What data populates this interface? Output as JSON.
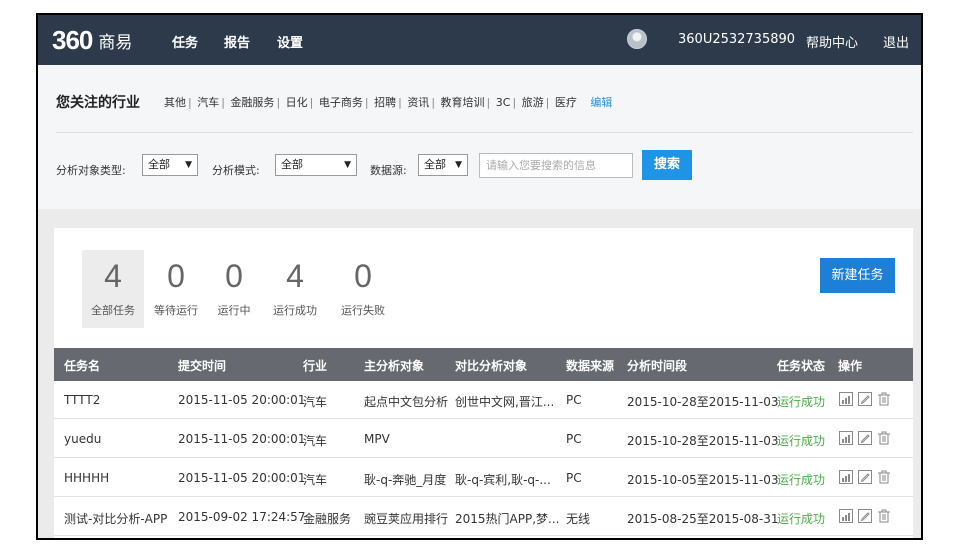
{
  "nav": {
    "logo_mark": "360",
    "logo_text": "商易",
    "links": [
      "任务",
      "报告",
      "设置"
    ],
    "username": "360U2532735890",
    "help": "帮助中心",
    "logout": "退出"
  },
  "filter": {
    "industry_title": "您关注的行业",
    "industries": [
      "其他",
      "汽车",
      "金融服务",
      "日化",
      "电子商务",
      "招聘",
      "资讯",
      "教育培训",
      "3C",
      "旅游",
      "医疗"
    ],
    "edit": "编辑",
    "target_type_label": "分析对象类型:",
    "target_type_value": "全部",
    "mode_label": "分析模式:",
    "mode_value": "全部",
    "source_label": "数据源:",
    "source_value": "全部",
    "search_placeholder": "请输入您要搜索的信息",
    "search_button": "搜索"
  },
  "stats": [
    {
      "value": "4",
      "label": "全部任务"
    },
    {
      "value": "0",
      "label": "等待运行"
    },
    {
      "value": "0",
      "label": "运行中"
    },
    {
      "value": "4",
      "label": "运行成功"
    },
    {
      "value": "0",
      "label": "运行失败"
    }
  ],
  "new_task": "新建任务",
  "table": {
    "headers": [
      "任务名",
      "提交时间",
      "行业",
      "主分析对象",
      "对比分析对象",
      "数据来源",
      "分析时间段",
      "任务状态",
      "操作"
    ],
    "rows": [
      [
        "TTTT2",
        "2015-11-05 20:00:01",
        "汽车",
        "起点中文包分析",
        "创世中文网,晋江...",
        "PC",
        "2015-10-28至2015-11-03",
        "运行成功"
      ],
      [
        "yuedu",
        "2015-11-05 20:00:01",
        "汽车",
        "MPV",
        "",
        "PC",
        "2015-10-28至2015-11-03",
        "运行成功"
      ],
      [
        "HHHHH",
        "2015-11-05 20:00:01",
        "汽车",
        "耿-q-奔驰_月度",
        "耿-q-宾利,耿-q-...",
        "PC",
        "2015-10-05至2015-11-03",
        "运行成功"
      ],
      [
        "测试-对比分析-APP",
        "2015-09-02 17:24:57",
        "金融服务",
        "豌豆荚应用排行",
        "2015热门APP,梦...",
        "无线",
        "2015-08-25至2015-08-31",
        "运行成功"
      ]
    ]
  },
  "colors": {
    "nav_bg": "#2d3a4b",
    "accent": "#1e94e6",
    "success": "#4cae4c",
    "table_header": "#666a70"
  }
}
